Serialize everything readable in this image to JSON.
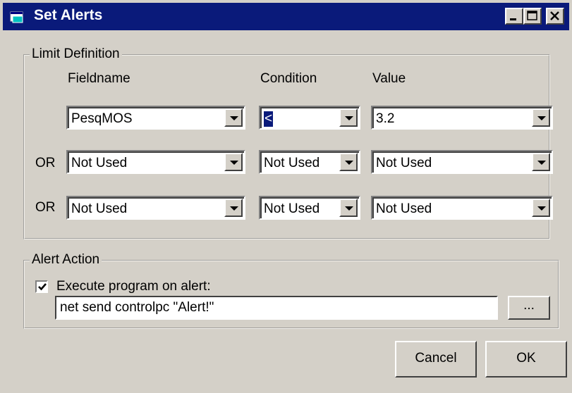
{
  "window": {
    "title": "Set Alerts",
    "title_bar_color": "#0a1a7a",
    "face_color": "#d4d0c8",
    "icons": [
      "app-icon",
      "minimize-icon",
      "maximize-icon",
      "close-icon"
    ]
  },
  "limit_definition": {
    "legend": "Limit Definition",
    "headers": {
      "fieldname": "Fieldname",
      "condition": "Condition",
      "value": "Value"
    },
    "rows": [
      {
        "prefix": "",
        "fieldname": "PesqMOS",
        "condition": "<",
        "value": "3.2"
      },
      {
        "prefix": "OR",
        "fieldname": "Not Used",
        "condition": "Not Used",
        "value": "Not Used"
      },
      {
        "prefix": "OR",
        "fieldname": "Not Used",
        "condition": "Not Used",
        "value": "Not Used"
      }
    ]
  },
  "alert_action": {
    "legend": "Alert Action",
    "checkbox_label": "Execute program on alert:",
    "checkbox_checked": true,
    "command": "net send controlpc \"Alert!\"",
    "browse_label": "..."
  },
  "buttons": {
    "cancel": "Cancel",
    "ok": "OK"
  }
}
